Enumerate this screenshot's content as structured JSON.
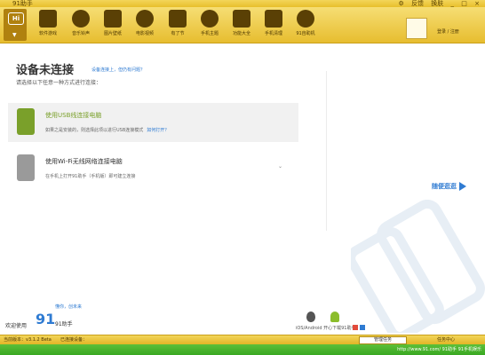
{
  "app": {
    "title": "91助手"
  },
  "window_controls": {
    "settings": "⚙",
    "feedback": "反馈",
    "skin": "换肤",
    "minimize": "_",
    "maximize": "□",
    "close": "×"
  },
  "toolbar": {
    "hi_label": "Hi",
    "items": [
      {
        "label": "软件游戏",
        "icon": "apps-grid-icon"
      },
      {
        "label": "音乐铃声",
        "icon": "music-note-icon"
      },
      {
        "label": "图片壁纸",
        "icon": "image-icon"
      },
      {
        "label": "电影视频",
        "icon": "film-reel-icon"
      },
      {
        "label": "有了节",
        "icon": "phone-square-icon"
      },
      {
        "label": "手机主题",
        "icon": "theme-brush-icon"
      },
      {
        "label": "功能大全",
        "icon": "toolbox-icon"
      },
      {
        "label": "手机清理",
        "icon": "trash-icon"
      },
      {
        "label": "91自助机",
        "icon": "91-circle-icon"
      }
    ],
    "login": "登录 / 注册"
  },
  "main": {
    "title": "设备未连接",
    "help_link": "设备连接上，但仍有问题？",
    "subtitle": "请选择以下任意一种方式进行连接：",
    "options": [
      {
        "title": "使用USB线连接电脑",
        "desc": "如果之是安装的，则选择此项以进行USB连接模式",
        "link": "如何打开？",
        "icon": "usb-plug-icon",
        "selected": true
      },
      {
        "title": "使用Wi-Fi无线网络连接电脑",
        "desc": "在手机上打开91助手（手机版）即可建立连接",
        "link": "",
        "icon": "phone-wifi-icon",
        "selected": false
      }
    ],
    "try_label": "随便逛逛"
  },
  "bottom": {
    "welcome": "欢迎使用",
    "logo_big": "91",
    "logo_text": "91助手",
    "logo_sig": "懂你，创未来",
    "platforms_text": "iOS/Android 开心下载91助手"
  },
  "status": {
    "version": "当前版本：v3.1.2 Beta",
    "progress": "已连接设备：",
    "box": "管理任务",
    "right": "任务中心"
  },
  "footer": {
    "url": "http://www.91.com/ 91助手 91手机娱乐"
  },
  "colors": {
    "accent_yellow": "#e8bf2b",
    "link_blue": "#2f7bd2",
    "green": "#39a822",
    "usb_green": "#7aa02a"
  }
}
